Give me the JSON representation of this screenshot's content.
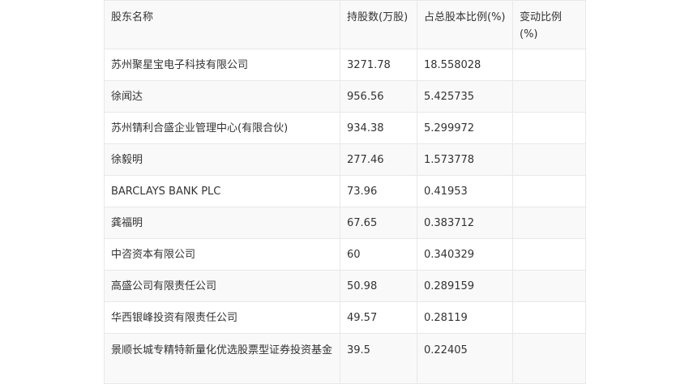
{
  "table": {
    "headers": [
      "股东名称",
      "持股数(万股)",
      "占总股本比例(%)",
      "变动比例(%)"
    ],
    "rows": [
      [
        "苏州聚星宝电子科技有限公司",
        "3271.78",
        "18.558028",
        ""
      ],
      [
        "徐闻达",
        "956.56",
        "5.425735",
        ""
      ],
      [
        "苏州锖利合盛企业管理中心(有限合伙)",
        "934.38",
        "5.299972",
        ""
      ],
      [
        "徐毅明",
        "277.46",
        "1.573778",
        ""
      ],
      [
        "BARCLAYS BANK PLC",
        "73.96",
        "0.41953",
        ""
      ],
      [
        "龚福明",
        "67.65",
        "0.383712",
        ""
      ],
      [
        "中咨资本有限公司",
        "60",
        "0.340329",
        ""
      ],
      [
        "高盛公司有限责任公司",
        "50.98",
        "0.289159",
        ""
      ],
      [
        "华西银峰投资有限责任公司",
        "49.57",
        "0.28119",
        ""
      ],
      [
        "景顺长城专精特新量化优选股票型证券投资基金",
        "39.5",
        "0.22405",
        ""
      ]
    ]
  }
}
